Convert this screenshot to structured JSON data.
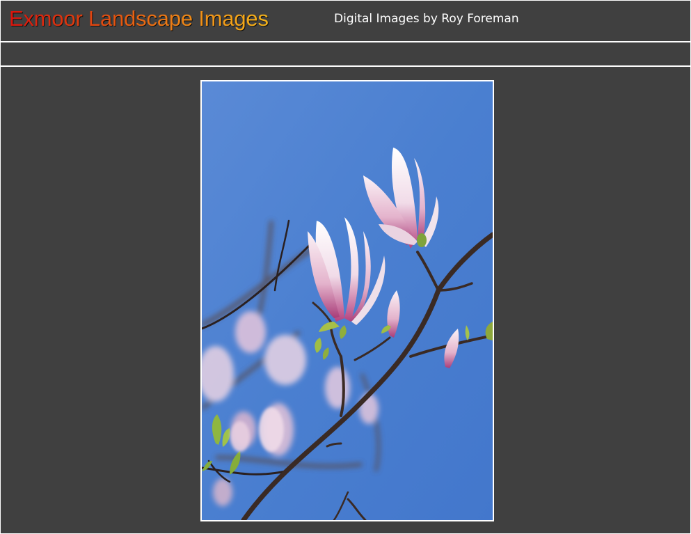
{
  "header": {
    "site_title": "Exmoor Landscape Images",
    "subtitle": "Digital Images by Roy Foreman"
  },
  "colors": {
    "background": "#404040",
    "border": "#ffffff",
    "title_gradient_start": "#d9140d",
    "title_gradient_end": "#f5b41a",
    "sky": "#4a7fcf"
  },
  "photo": {
    "subject": "magnolia-blossoms-on-branch"
  }
}
